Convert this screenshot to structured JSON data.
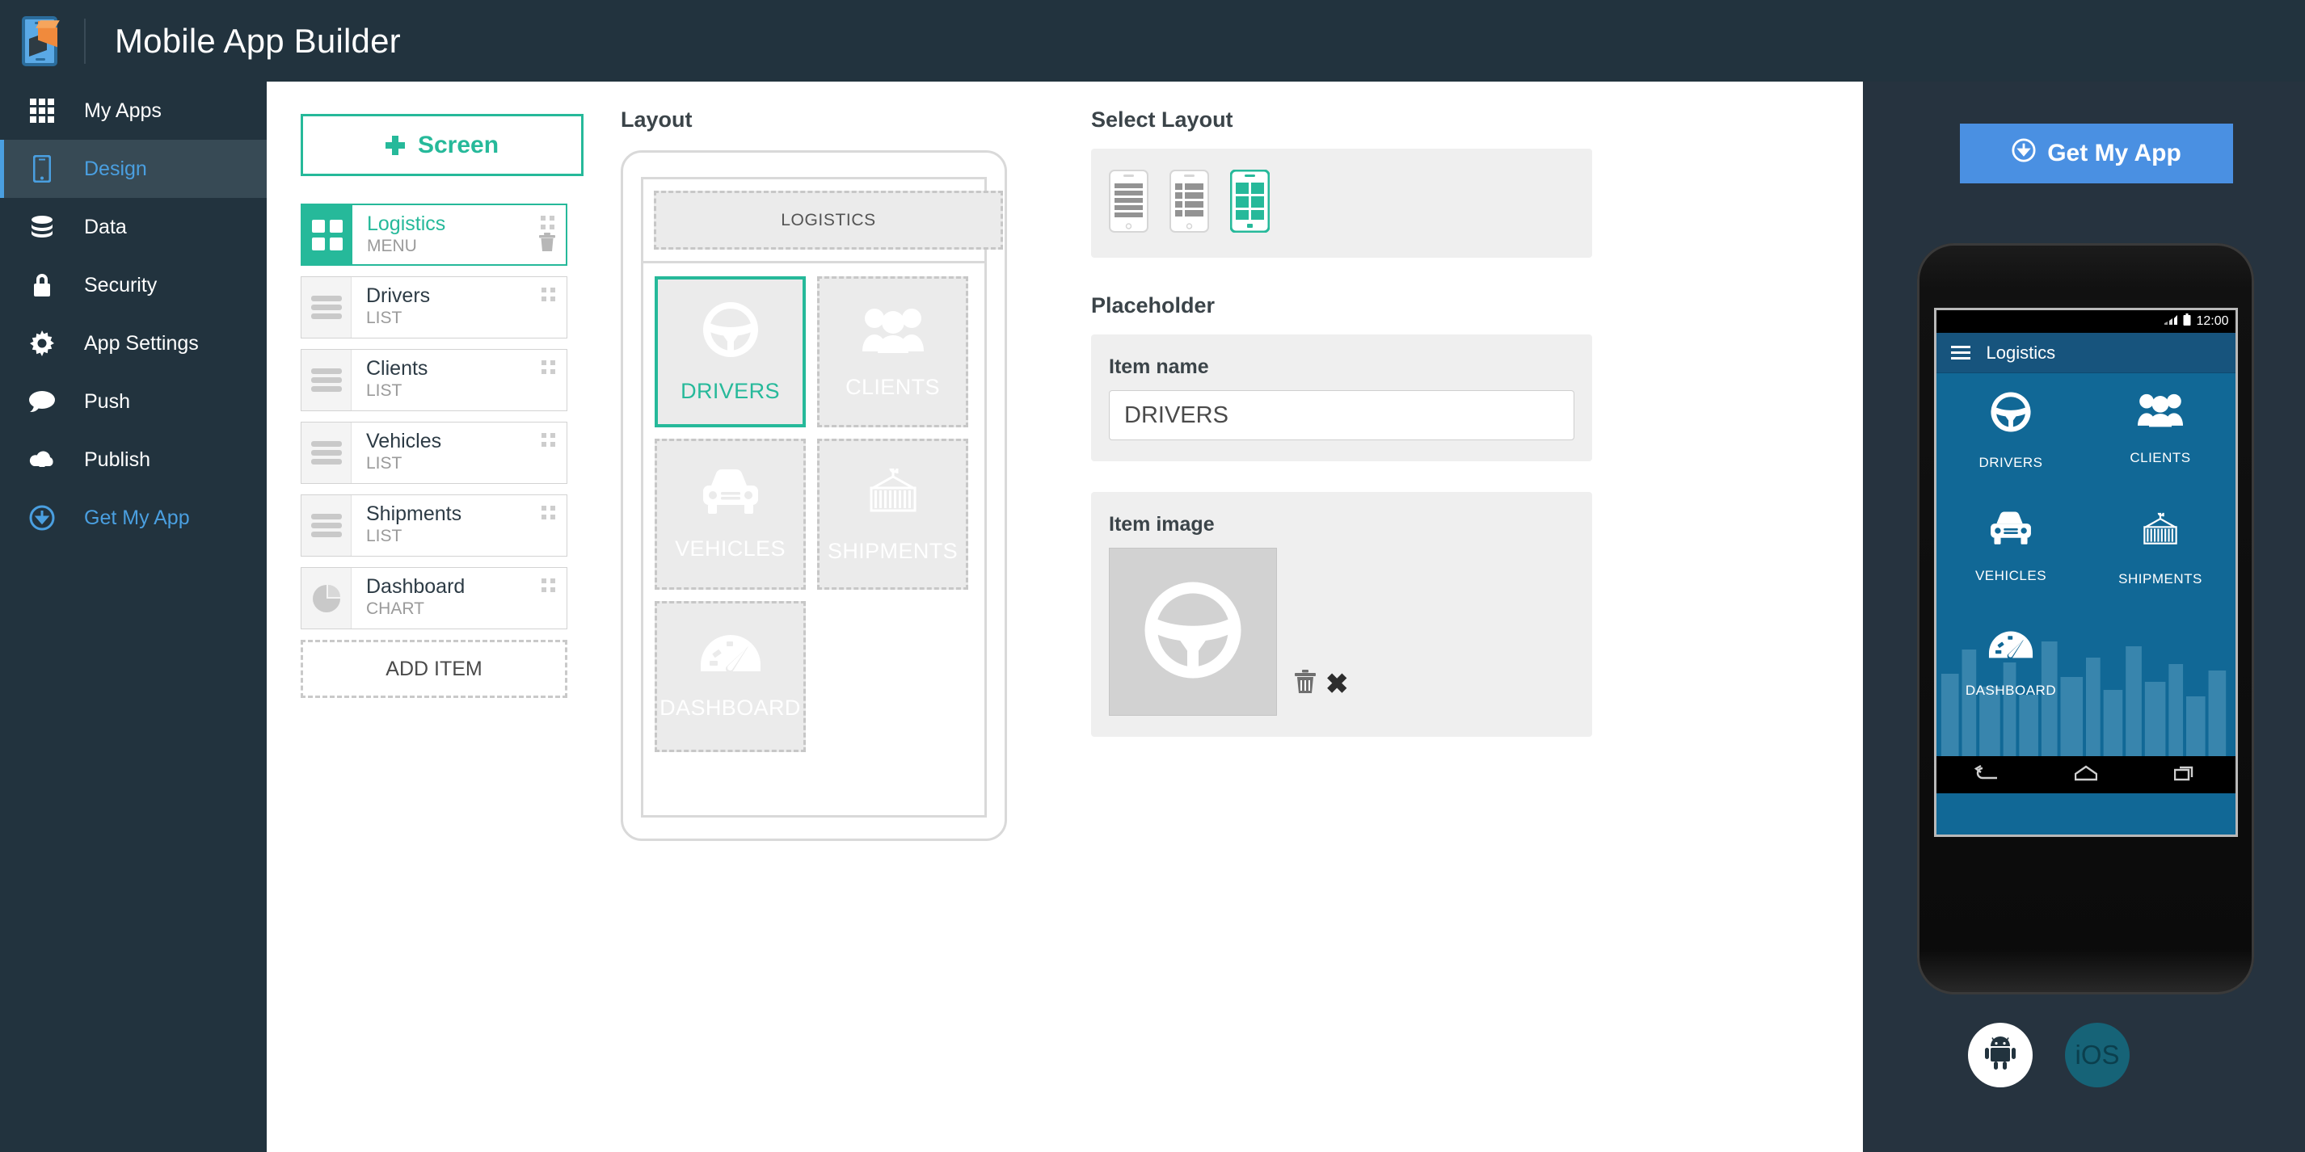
{
  "app": {
    "title": "Mobile App Builder",
    "logo_icon": "phone-cube-logo"
  },
  "sidebar": {
    "items": [
      {
        "label": "My Apps",
        "icon": "grid-icon",
        "active": false
      },
      {
        "label": "Design",
        "icon": "mobile-phone-icon",
        "active": true
      },
      {
        "label": "Data",
        "icon": "database-icon",
        "active": false
      },
      {
        "label": "Security",
        "icon": "lock-icon",
        "active": false
      },
      {
        "label": "App Settings",
        "icon": "gear-icon",
        "active": false
      },
      {
        "label": "Push",
        "icon": "chat-bubble-icon",
        "active": false
      },
      {
        "label": "Publish",
        "icon": "cloud-upload-icon",
        "active": false
      },
      {
        "label": "Get My App",
        "icon": "download-circle-icon",
        "active": false
      }
    ]
  },
  "screens_panel": {
    "add_screen_label": "Screen",
    "add_item_label": "ADD ITEM",
    "items": [
      {
        "name": "Logistics",
        "type": "MENU",
        "icon": "grid-four-icon",
        "selected": true
      },
      {
        "name": "Drivers",
        "type": "LIST",
        "icon": "list-bars-icon",
        "selected": false
      },
      {
        "name": "Clients",
        "type": "LIST",
        "icon": "list-bars-icon",
        "selected": false
      },
      {
        "name": "Vehicles",
        "type": "LIST",
        "icon": "list-bars-icon",
        "selected": false
      },
      {
        "name": "Shipments",
        "type": "LIST",
        "icon": "list-bars-icon",
        "selected": false
      },
      {
        "name": "Dashboard",
        "type": "CHART",
        "icon": "pie-chart-icon",
        "selected": false
      }
    ]
  },
  "layout_panel": {
    "title": "Layout",
    "header_tile_label": "LOGISTICS",
    "tiles": [
      {
        "label": "DRIVERS",
        "icon": "steering-wheel-icon",
        "selected": true
      },
      {
        "label": "CLIENTS",
        "icon": "people-group-icon",
        "selected": false
      },
      {
        "label": "VEHICLES",
        "icon": "car-front-icon",
        "selected": false
      },
      {
        "label": "SHIPMENTS",
        "icon": "container-icon",
        "selected": false
      },
      {
        "label": "DASHBOARD",
        "icon": "gauge-icon",
        "selected": false
      }
    ]
  },
  "settings_panel": {
    "select_layout_title": "Select Layout",
    "layout_options": [
      {
        "name": "list-lines-layout",
        "selected": false
      },
      {
        "name": "list-thumbs-layout",
        "selected": false
      },
      {
        "name": "grid-layout",
        "selected": true
      }
    ],
    "placeholder_title": "Placeholder",
    "item_name_label": "Item name",
    "item_name_value": "DRIVERS",
    "item_name_placeholder": "Item name",
    "item_image_label": "Item image",
    "item_image_icon": "steering-wheel-icon",
    "delete_icon": "trash-icon",
    "remove_icon": "close-x-icon"
  },
  "preview": {
    "get_my_app_label": "Get My App",
    "get_my_app_icon": "download-circle-icon",
    "status_time": "12:00",
    "status_signal_icon": "signal-lte-icon",
    "status_battery_icon": "battery-icon",
    "app_bar_title": "Logistics",
    "menu_icon": "hamburger-menu-icon",
    "grid": [
      {
        "label": "DRIVERS",
        "icon": "steering-wheel-icon"
      },
      {
        "label": "CLIENTS",
        "icon": "people-group-icon"
      },
      {
        "label": "VEHICLES",
        "icon": "car-front-icon"
      },
      {
        "label": "SHIPMENTS",
        "icon": "container-icon"
      },
      {
        "label": "DASHBOARD",
        "icon": "gauge-icon"
      }
    ],
    "nav_buttons": [
      "back-icon",
      "home-icon",
      "recents-icon"
    ],
    "platforms": [
      {
        "label": "",
        "icon": "android-icon",
        "selected": true
      },
      {
        "label": "iOS",
        "icon": "ios-text",
        "selected": false
      }
    ]
  },
  "colors": {
    "accent_teal": "#26b99a",
    "sidebar_bg": "#22333e",
    "link_blue": "#4a9fe0",
    "button_blue": "#4a90e2",
    "preview_blue": "#116896"
  }
}
